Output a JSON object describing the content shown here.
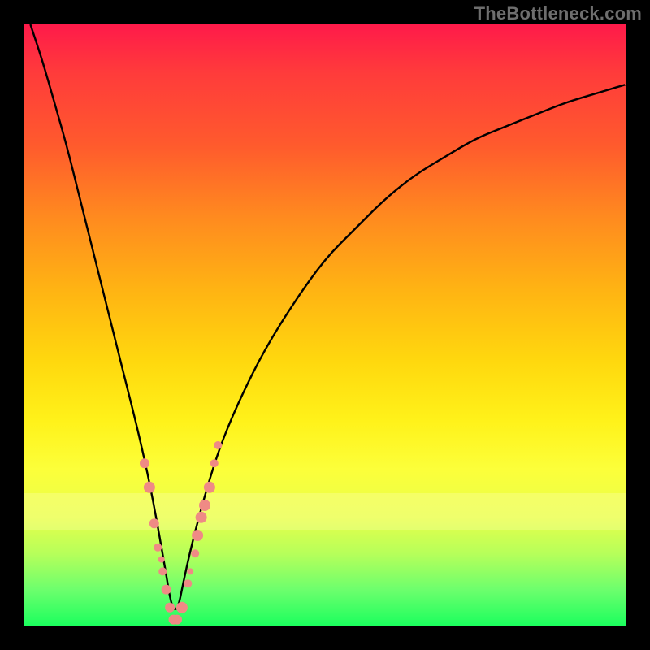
{
  "watermark": "TheBottleneck.com",
  "yellow_band": {
    "top_frac": 0.78,
    "height_frac": 0.06
  },
  "chart_data": {
    "type": "line",
    "title": "",
    "xlabel": "",
    "ylabel": "",
    "xlim": [
      0,
      100
    ],
    "ylim": [
      0,
      100
    ],
    "grid": false,
    "legend": false,
    "x_min_at": 25,
    "series": [
      {
        "name": "bottleneck-curve",
        "x": [
          1,
          3,
          5,
          7,
          9,
          11,
          13,
          15,
          17,
          19,
          21,
          23,
          25,
          27,
          29,
          31,
          33,
          36,
          40,
          45,
          50,
          55,
          60,
          65,
          70,
          75,
          80,
          85,
          90,
          95,
          100
        ],
        "y": [
          100,
          94,
          87,
          80,
          72,
          64,
          56,
          48,
          40,
          32,
          23,
          12,
          0,
          10,
          18,
          25,
          31,
          38,
          46,
          54,
          61,
          66,
          71,
          75,
          78,
          81,
          83,
          85,
          87,
          88.5,
          90
        ]
      }
    ],
    "markers": [
      {
        "x": 20.0,
        "y": 27,
        "r": 6
      },
      {
        "x": 20.8,
        "y": 23,
        "r": 7
      },
      {
        "x": 21.6,
        "y": 17,
        "r": 6
      },
      {
        "x": 22.2,
        "y": 13,
        "r": 5
      },
      {
        "x": 22.8,
        "y": 11,
        "r": 4
      },
      {
        "x": 23.0,
        "y": 9,
        "r": 5
      },
      {
        "x": 23.6,
        "y": 6,
        "r": 6
      },
      {
        "x": 24.2,
        "y": 3,
        "r": 6
      },
      {
        "x": 24.8,
        "y": 1,
        "r": 6
      },
      {
        "x": 25.4,
        "y": 1,
        "r": 6
      },
      {
        "x": 26.2,
        "y": 3,
        "r": 7
      },
      {
        "x": 27.2,
        "y": 7,
        "r": 5
      },
      {
        "x": 27.6,
        "y": 9,
        "r": 4
      },
      {
        "x": 28.4,
        "y": 12,
        "r": 5
      },
      {
        "x": 28.8,
        "y": 15,
        "r": 7
      },
      {
        "x": 29.4,
        "y": 18,
        "r": 7
      },
      {
        "x": 30.0,
        "y": 20,
        "r": 7
      },
      {
        "x": 30.8,
        "y": 23,
        "r": 7
      },
      {
        "x": 31.6,
        "y": 27,
        "r": 5
      },
      {
        "x": 32.2,
        "y": 30,
        "r": 5
      }
    ],
    "colors": {
      "curve": "#000000",
      "marker": "#ef8a85"
    }
  }
}
